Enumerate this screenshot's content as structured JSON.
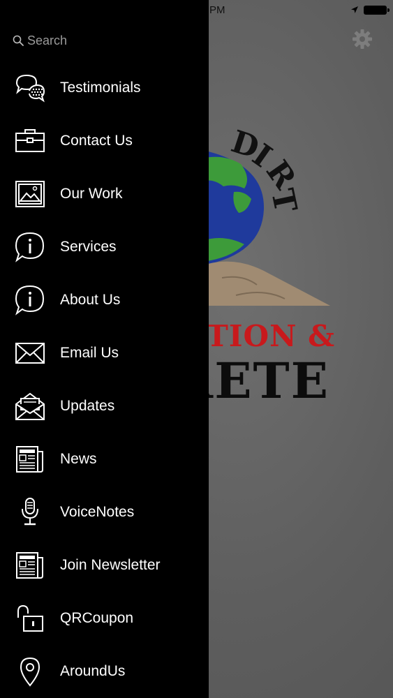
{
  "status_bar": {
    "time_fragment": "PM"
  },
  "logo": {
    "arc_text": [
      "D",
      "I",
      "R",
      "T"
    ],
    "line1": "TION &",
    "line2": "RETE"
  },
  "search": {
    "placeholder": "Search"
  },
  "menu": {
    "items": [
      {
        "label": "Testimonials",
        "icon": "speech-bubbles-icon"
      },
      {
        "label": "Contact Us",
        "icon": "briefcase-icon"
      },
      {
        "label": "Our Work",
        "icon": "image-icon"
      },
      {
        "label": "Services",
        "icon": "info-bubble-icon"
      },
      {
        "label": "About Us",
        "icon": "info-bubble-icon"
      },
      {
        "label": "Email Us",
        "icon": "envelope-icon"
      },
      {
        "label": "Updates",
        "icon": "open-envelope-icon"
      },
      {
        "label": "News",
        "icon": "newspaper-icon"
      },
      {
        "label": "VoiceNotes",
        "icon": "microphone-icon"
      },
      {
        "label": "Join Newsletter",
        "icon": "newspaper-icon"
      },
      {
        "label": "QRCoupon",
        "icon": "unlocked-padlock-icon"
      },
      {
        "label": "AroundUs",
        "icon": "map-pin-icon"
      }
    ]
  },
  "colors": {
    "drawer_background": "#000000",
    "menu_text": "#ffffff",
    "logo_red": "#c8191c",
    "app_background": "#5e5e5e"
  }
}
